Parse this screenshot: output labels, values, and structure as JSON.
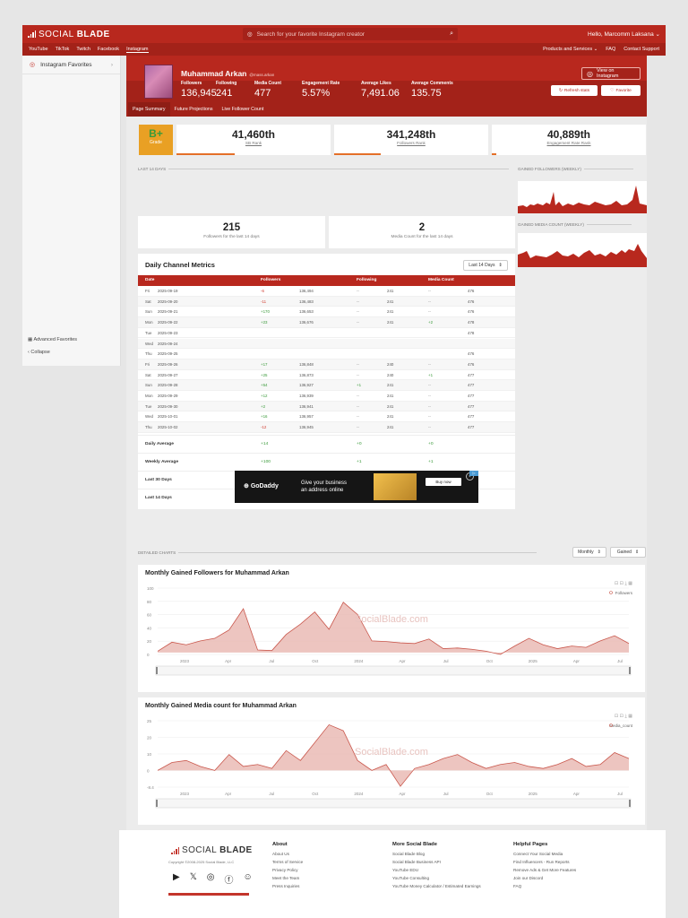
{
  "header": {
    "logo_light": "SOCIAL",
    "logo_bold": "BLADE",
    "search_placeholder": "Search for your favorite Instagram creator",
    "greeting": "Hello, Marcomm Laksana"
  },
  "nav": {
    "platforms": [
      "YouTube",
      "TikTok",
      "Twitch",
      "Facebook",
      "Instagram"
    ],
    "active": "Instagram",
    "right": [
      "Products and Services",
      "FAQ",
      "Contact Support"
    ]
  },
  "sidebar": {
    "favorites_label": "Instagram Favorites",
    "advanced_favorites": "Advanced Favorites",
    "collapse": "Collapse"
  },
  "profile": {
    "name": "Muhammad Arkan",
    "handle": "@mass.arkan",
    "view_button": "View on Instagram",
    "refresh_button": "Refresh stats",
    "favorite_button": "Favorite",
    "stats": [
      {
        "label": "Followers",
        "value": "136,945"
      },
      {
        "label": "Following",
        "value": "241"
      },
      {
        "label": "Media Count",
        "value": "477"
      },
      {
        "label": "Engagement Rate",
        "value": "5.57%"
      },
      {
        "label": "Average Likes",
        "value": "7,491.06"
      },
      {
        "label": "Average Comments",
        "value": "135.75"
      }
    ]
  },
  "subtabs": [
    "Page Summary",
    "Future Projections",
    "Live Follower Count"
  ],
  "grade": {
    "value": "B+",
    "label": "Grade"
  },
  "ranks": [
    {
      "value": "41,460th",
      "label": "SB Rank",
      "bar_pct": 38
    },
    {
      "value": "341,248th",
      "label": "Followers Rank",
      "bar_pct": 30
    },
    {
      "value": "40,889th",
      "label": "Engagement Rate Rank",
      "bar_pct": 3
    }
  ],
  "last14": {
    "label": "LAST 14 DAYS",
    "followers_value": "215",
    "followers_label": "Followers for the last 14 days",
    "media_value": "2",
    "media_label": "Media Count for the last 14 days"
  },
  "side_charts": {
    "followers_label": "GAINED FOLLOWERS (WEEKLY)",
    "media_label": "GAINED MEDIA COUNT (WEEKLY)"
  },
  "metrics": {
    "title": "Daily Channel Metrics",
    "range": "Last 14 Days",
    "headers": [
      "Date",
      "Followers",
      "Following",
      "Media Count"
    ],
    "rows": [
      {
        "day": "Fri",
        "date": "2025-09-19",
        "fd": "-6",
        "f": "136,494",
        "gd": "--",
        "g": "241",
        "md": "--",
        "m": "476"
      },
      {
        "day": "Sat",
        "date": "2025-09-20",
        "fd": "-11",
        "f": "136,483",
        "gd": "--",
        "g": "241",
        "md": "--",
        "m": "476"
      },
      {
        "day": "Sun",
        "date": "2025-09-21",
        "fd": "+170",
        "f": "136,653",
        "gd": "--",
        "g": "241",
        "md": "--",
        "m": "476"
      },
      {
        "day": "Mon",
        "date": "2025-09-22",
        "fd": "+23",
        "f": "136,676",
        "gd": "--",
        "g": "241",
        "md": "+2",
        "m": "478"
      },
      {
        "day": "Tue",
        "date": "2025-09-23",
        "fd": "",
        "f": "",
        "gd": "",
        "g": "",
        "md": "",
        "m": "478"
      },
      {
        "day": "Wed",
        "date": "2025-09-24",
        "fd": "",
        "f": "",
        "gd": "",
        "g": "",
        "md": "",
        "m": ""
      },
      {
        "day": "Thu",
        "date": "2025-09-25",
        "fd": "",
        "f": "",
        "gd": "",
        "g": "",
        "md": "",
        "m": "476"
      },
      {
        "day": "Fri",
        "date": "2025-09-26",
        "fd": "+17",
        "f": "136,848",
        "gd": "--",
        "g": "240",
        "md": "--",
        "m": "476"
      },
      {
        "day": "Sat",
        "date": "2025-09-27",
        "fd": "+25",
        "f": "136,873",
        "gd": "--",
        "g": "240",
        "md": "+1",
        "m": "477"
      },
      {
        "day": "Sun",
        "date": "2025-09-28",
        "fd": "+54",
        "f": "136,927",
        "gd": "+1",
        "g": "241",
        "md": "--",
        "m": "477"
      },
      {
        "day": "Mon",
        "date": "2025-09-29",
        "fd": "+12",
        "f": "136,939",
        "gd": "--",
        "g": "241",
        "md": "--",
        "m": "477"
      },
      {
        "day": "Tue",
        "date": "2025-09-30",
        "fd": "+2",
        "f": "136,941",
        "gd": "--",
        "g": "241",
        "md": "--",
        "m": "477"
      },
      {
        "day": "Wed",
        "date": "2025-10-01",
        "fd": "+16",
        "f": "136,957",
        "gd": "--",
        "g": "241",
        "md": "--",
        "m": "477"
      },
      {
        "day": "Thu",
        "date": "2025-10-02",
        "fd": "-12",
        "f": "136,945",
        "gd": "--",
        "g": "241",
        "md": "--",
        "m": "477"
      }
    ],
    "summary": [
      {
        "label": "Daily Average",
        "f": "+14",
        "g": "+0",
        "m": "+0"
      },
      {
        "label": "Weekly Average",
        "f": "+100",
        "g": "+1",
        "m": "+1"
      },
      {
        "label": "Last 30 Days",
        "f": "+730",
        "g": "+3",
        "m": "+6"
      },
      {
        "label": "Last 14 Days",
        "f": "+215",
        "g": "0",
        "m": "+2"
      }
    ]
  },
  "ad": {
    "brand": "GoDaddy",
    "text_line1": "Give your business",
    "text_line2": "an address online",
    "cta": "Buy now"
  },
  "detailed": {
    "label": "DETAILED CHARTS",
    "period": "Monthly",
    "mode": "Gained"
  },
  "chart_data": [
    {
      "type": "area",
      "title": "Monthly Gained Followers for Muhammad Arkan",
      "legend": "Followers",
      "watermark": "SocialBlade.com",
      "y_ticks": [
        "100",
        "80",
        "60",
        "40",
        "20",
        "0"
      ],
      "x_ticks": [
        "2023",
        "Apr",
        "Jul",
        "Oct",
        "2024",
        "Apr",
        "Jul",
        "Oct",
        "2025",
        "Apr",
        "Jul"
      ],
      "values": [
        2,
        16,
        12,
        18,
        22,
        35,
        68,
        4,
        3,
        28,
        44,
        63,
        36,
        78,
        59,
        18,
        17,
        15,
        14,
        21,
        6,
        7,
        5,
        2,
        -3,
        10,
        22,
        12,
        6,
        10,
        8,
        18,
        26,
        14
      ],
      "ylim": [
        -3,
        100
      ]
    },
    {
      "type": "area",
      "title": "Monthly Gained Media count for Muhammad Arkan",
      "legend": "Media_count",
      "watermark": "SocialBlade.com",
      "y_ticks": [
        "25",
        "20",
        "10",
        "0",
        "-8.4"
      ],
      "x_ticks": [
        "2023",
        "Apr",
        "Jul",
        "Oct",
        "2024",
        "Apr",
        "Jul",
        "Oct",
        "2025",
        "Apr",
        "Jul"
      ],
      "values": [
        0,
        4,
        5,
        2,
        0,
        8,
        2,
        3,
        1,
        10,
        5,
        14,
        23,
        20,
        5,
        0,
        3,
        -8,
        1,
        3,
        6,
        8,
        4,
        1,
        3,
        4,
        2,
        1,
        3,
        6,
        2,
        3,
        9,
        6
      ],
      "ylim": [
        -8.4,
        25
      ]
    }
  ],
  "footer": {
    "logo_light": "SOCIAL",
    "logo_bold": "BLADE",
    "copyright": "Copyright ©2008-2025 Social Blade, LLC",
    "about_title": "About",
    "about": [
      "About Us",
      "Terms of Service",
      "Privacy Policy",
      "Meet the Team",
      "Press Inquiries"
    ],
    "more_title": "More Social Blade",
    "more": [
      "Social Blade Blog",
      "Social Blade Business API",
      "YouTube EDU",
      "YouTube Consulting",
      "YouTube Money Calculator / Estimated Earnings"
    ],
    "help_title": "Helpful Pages",
    "help": [
      "Connect Your Social Media",
      "Find Influencers - Run Reports",
      "Remove Ads & Get More Features",
      "Join our Discord",
      "FAQ"
    ]
  }
}
